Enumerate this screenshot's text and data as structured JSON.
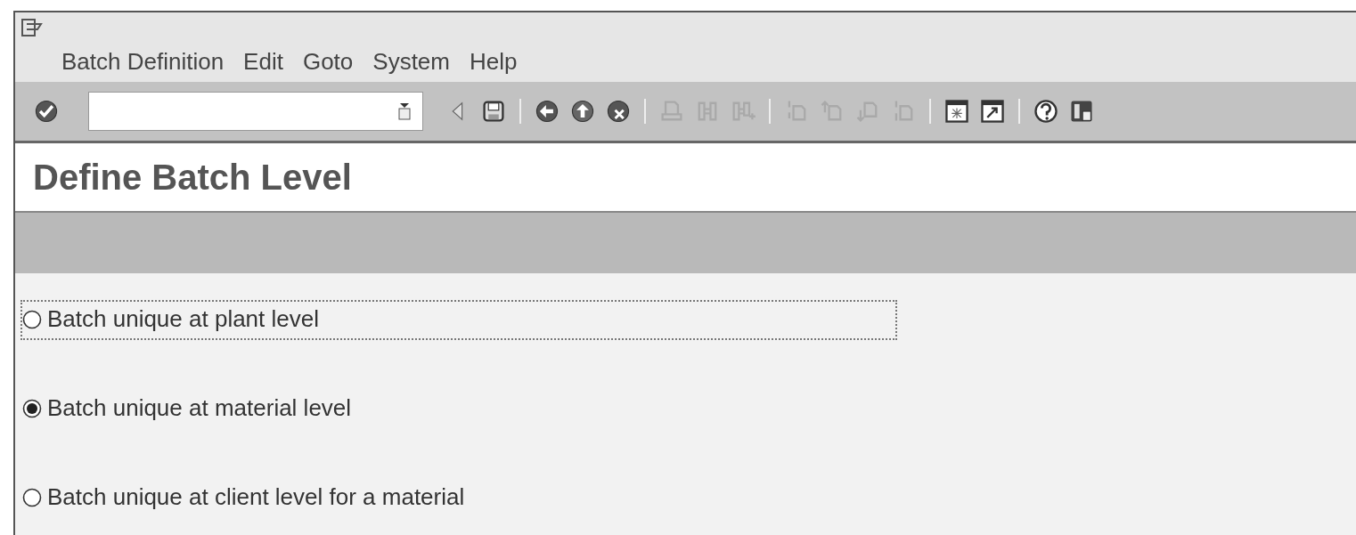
{
  "menu_bar": {
    "items": [
      "Batch Definition",
      "Edit",
      "Goto",
      "System",
      "Help"
    ]
  },
  "toolbar": [
    {
      "kind": "enter",
      "disabled": false
    },
    {
      "kind": "command",
      "disabled": false
    },
    {
      "kind": "previous",
      "disabled": false
    },
    {
      "kind": "save",
      "disabled": false
    },
    {
      "kind": "separator"
    },
    {
      "kind": "back",
      "disabled": false
    },
    {
      "kind": "exit",
      "disabled": false
    },
    {
      "kind": "cancel",
      "disabled": false
    },
    {
      "kind": "separator"
    },
    {
      "kind": "print",
      "disabled": true
    },
    {
      "kind": "find",
      "disabled": true
    },
    {
      "kind": "findnext",
      "disabled": true
    },
    {
      "kind": "separator"
    },
    {
      "kind": "first",
      "disabled": true
    },
    {
      "kind": "prev",
      "disabled": true
    },
    {
      "kind": "next",
      "disabled": true
    },
    {
      "kind": "last",
      "disabled": true
    },
    {
      "kind": "separator"
    },
    {
      "kind": "session",
      "disabled": false
    },
    {
      "kind": "shortcut",
      "disabled": false
    },
    {
      "kind": "separator"
    },
    {
      "kind": "help",
      "disabled": false
    },
    {
      "kind": "layout",
      "disabled": false
    }
  ],
  "title": "Define Batch Level",
  "options": [
    {
      "label": "Batch unique at plant level",
      "selected": false,
      "focused": true
    },
    {
      "label": "Batch unique at material level",
      "selected": true,
      "focused": false
    },
    {
      "label": "Batch unique at client level for a material",
      "selected": false,
      "focused": false
    }
  ]
}
